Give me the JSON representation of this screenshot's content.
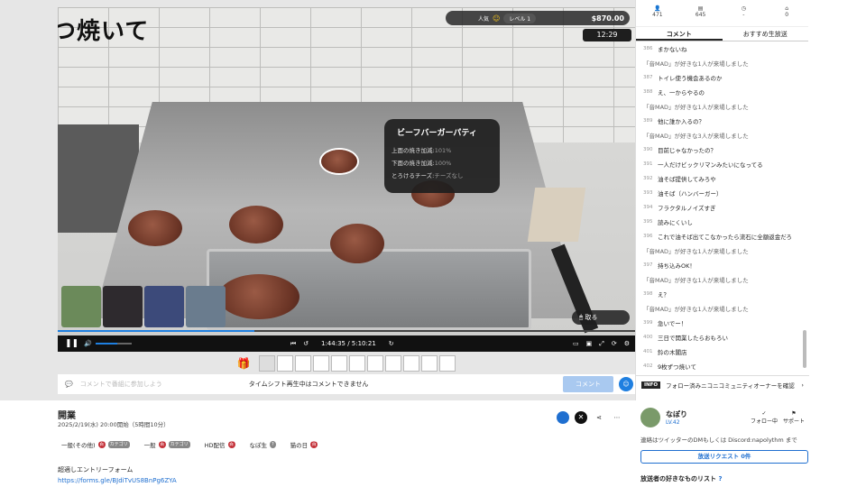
{
  "video": {
    "overlay_title": "つ焼いて",
    "stats": {
      "people_label": "人気",
      "level_label": "レベル 1",
      "money": "$870.00"
    },
    "game_time": "12:29",
    "item_card": {
      "title": "ビーフバーガーパティ",
      "rows": [
        {
          "label": "上面の焼き加減:",
          "value": "101%"
        },
        {
          "label": "下面の焼き加減:",
          "value": "100%"
        },
        {
          "label": "とろけるチーズ:",
          "value": "チーズなし"
        }
      ]
    },
    "grab_label": "取る"
  },
  "controls": {
    "time": "1:44:35 / 5:10:21"
  },
  "comment_bar": {
    "placeholder": "コメントで番組に参加しよう",
    "notice": "タイムシフト再生中はコメントできません",
    "submit": "コメント"
  },
  "counts": [
    {
      "icon": "viewer-icon",
      "value": "471"
    },
    {
      "icon": "comment-count-icon",
      "value": "645"
    },
    {
      "icon": "ad-icon",
      "value": "-"
    },
    {
      "icon": "gift-icon",
      "value": "0"
    }
  ],
  "tabs": [
    "コメント",
    "おすすめ生放送"
  ],
  "comments": [
    {
      "n": "386",
      "t": "まかないね"
    },
    {
      "n": "",
      "t": "「音MAD」が好きな1人が来場しました",
      "sys": true
    },
    {
      "n": "387",
      "t": "トイレ使う機会あるのか"
    },
    {
      "n": "388",
      "t": "え、一からやるの"
    },
    {
      "n": "",
      "t": "「音MAD」が好きな1人が来場しました",
      "sys": true
    },
    {
      "n": "389",
      "t": "他に誰か入るの？"
    },
    {
      "n": "",
      "t": "「音MAD」が好きな3人が来場しました",
      "sys": true
    },
    {
      "n": "390",
      "t": "目前じゃなかったの？"
    },
    {
      "n": "391",
      "t": "一人だけビックリマンみたいになってる"
    },
    {
      "n": "392",
      "t": "油そば提供してみろや"
    },
    {
      "n": "393",
      "t": "油そば（ハンバーガー）"
    },
    {
      "n": "394",
      "t": "フラクタルノイズすぎ"
    },
    {
      "n": "395",
      "t": "読みにくいし"
    },
    {
      "n": "396",
      "t": "これで油そば出てこなかったら流石に全額返金だろ"
    },
    {
      "n": "",
      "t": "「音MAD」が好きな1人が来場しました",
      "sys": true
    },
    {
      "n": "397",
      "t": "持ち込みOK！"
    },
    {
      "n": "",
      "t": "「音MAD」が好きな1人が来場しました",
      "sys": true
    },
    {
      "n": "398",
      "t": "え？"
    },
    {
      "n": "",
      "t": "「音MAD」が好きな1人が来場しました",
      "sys": true
    },
    {
      "n": "399",
      "t": "急いでー！"
    },
    {
      "n": "400",
      "t": "三日で開業したらおもろい"
    },
    {
      "n": "401",
      "t": "鈴の木閣店"
    },
    {
      "n": "402",
      "t": "9枚ずつ焼いて"
    }
  ],
  "follow_info": {
    "tag": "INFO",
    "text": "フォロー済みニコニコミュニティオーナーを確認"
  },
  "program": {
    "title": "開業",
    "date": "2025/2/19(水) 20:00開始（5時間10分）",
    "tags": [
      {
        "label": "一般(その他)",
        "badge": "カテゴリ"
      },
      {
        "label": "一般",
        "badge": "カテゴリ"
      },
      {
        "label": "HD配信",
        "badge": ""
      },
      {
        "label": "なぽ生",
        "badge": "?"
      },
      {
        "label": "猫の日",
        "badge": ""
      }
    ],
    "desc": "超適しエントリーフォーム",
    "link": "https://forms.gle/BJdiTvUS8BnPg6ZYA"
  },
  "owner": {
    "name": "なぽり",
    "level": "LV.42",
    "follow": "フォロー中",
    "support": "サポート",
    "note": "連絡はツイッターのDMもしくは Discord:napolythm まで",
    "request": "放送リクエスト 0件",
    "favorites": "放送者の好きなものリスト"
  }
}
